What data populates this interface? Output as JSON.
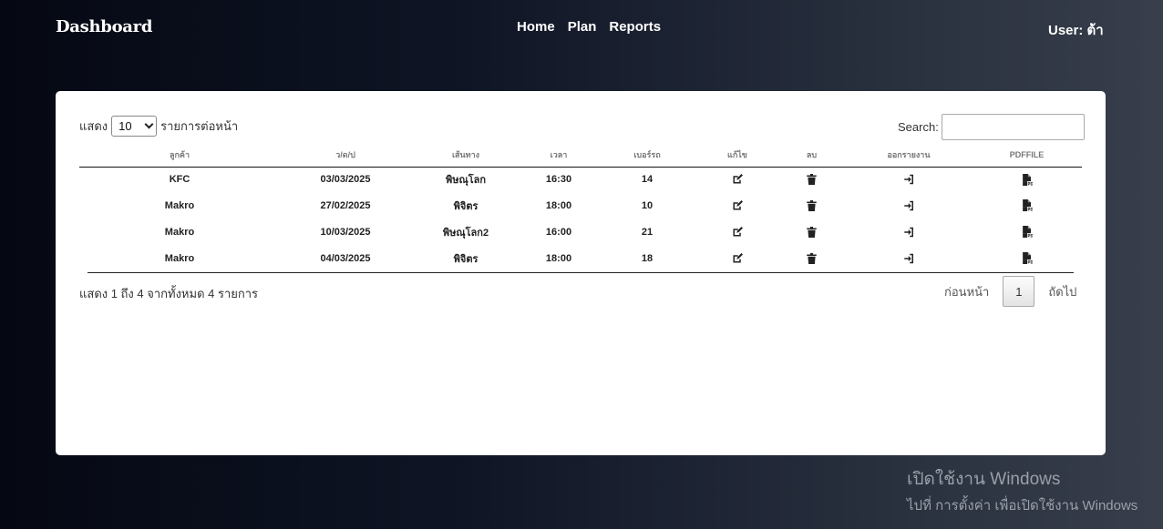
{
  "header": {
    "brand": "Dashboard",
    "nav": [
      "Home",
      "Plan",
      "Reports"
    ],
    "user": "User: ต้า"
  },
  "table_controls": {
    "show_label": "แสดง",
    "page_size": "10",
    "per_page_label": "รายการต่อหน้า",
    "search_label": "Search:",
    "search_value": ""
  },
  "table": {
    "columns": [
      "ลูกค้า",
      "ว/ด/ป",
      "เส้นทาง",
      "เวลา",
      "เบอร์รถ",
      "แก้ไข",
      "ลบ",
      "ออกรายงาน",
      "PDFFILE"
    ],
    "rows": [
      [
        "KFC",
        "03/03/2025",
        "พิษณุโลก",
        "16:30",
        "14"
      ],
      [
        "Makro",
        "27/02/2025",
        "พิจิตร",
        "18:00",
        "10"
      ],
      [
        "Makro",
        "10/03/2025",
        "พิษณุโลก2",
        "16:00",
        "21"
      ],
      [
        "Makro",
        "04/03/2025",
        "พิจิตร",
        "18:00",
        "18"
      ]
    ],
    "row_icons": [
      "edit-icon",
      "trash-icon",
      "sign-in-icon",
      "pdf-file-icon"
    ]
  },
  "footer": {
    "info": "แสดง 1 ถึง 4 จากทั้งหมด 4 รายการ",
    "prev": "ก่อนหน้า",
    "page": "1",
    "next": "ถัดไป"
  },
  "watermark": {
    "line1": "เปิดใช้งาน Windows",
    "line2": "ไปที่ การตั้งค่า เพื่อเปิดใช้งาน Windows"
  }
}
